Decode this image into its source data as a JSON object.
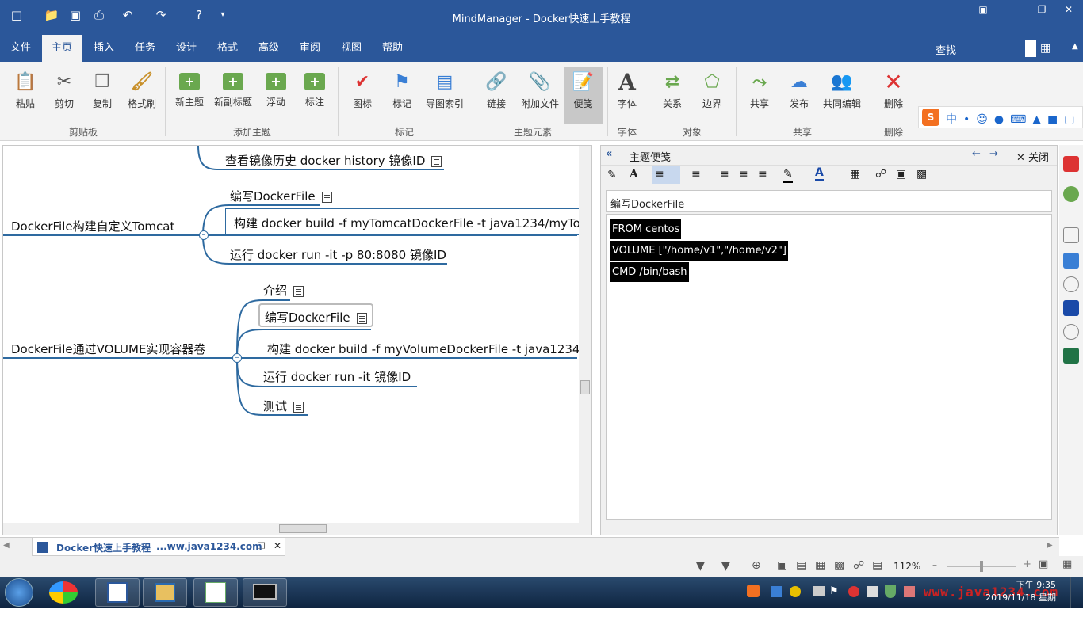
{
  "window": {
    "title": "MindManager - Docker快速上手教程"
  },
  "menu": {
    "tabs": [
      "文件",
      "主页",
      "插入",
      "任务",
      "设计",
      "格式",
      "高级",
      "审阅",
      "视图",
      "帮助"
    ],
    "active": "主页",
    "search_label": "查找"
  },
  "ribbon": {
    "buttons": [
      {
        "label": "粘贴",
        "icon": "paste-icon"
      },
      {
        "label": "剪切",
        "icon": "cut-icon"
      },
      {
        "label": "复制",
        "icon": "copy-icon"
      },
      {
        "label": "格式刷",
        "icon": "format-painter-icon"
      },
      {
        "label": "新主题",
        "icon": "new-topic-icon"
      },
      {
        "label": "新副标题",
        "icon": "new-subtopic-icon"
      },
      {
        "label": "浮动",
        "icon": "floating-topic-icon"
      },
      {
        "label": "标注",
        "icon": "callout-icon"
      },
      {
        "label": "图标",
        "icon": "icon-marker-icon"
      },
      {
        "label": "标记",
        "icon": "tag-icon"
      },
      {
        "label": "导图索引",
        "icon": "map-index-icon"
      },
      {
        "label": "链接",
        "icon": "link-icon"
      },
      {
        "label": "附加文件",
        "icon": "attachment-icon"
      },
      {
        "label": "便笺",
        "icon": "notes-icon"
      },
      {
        "label": "字体",
        "icon": "font-icon"
      },
      {
        "label": "关系",
        "icon": "relationship-icon"
      },
      {
        "label": "边界",
        "icon": "boundary-icon"
      },
      {
        "label": "共享",
        "icon": "share-icon"
      },
      {
        "label": "发布",
        "icon": "publish-icon"
      },
      {
        "label": "共同编辑",
        "icon": "co-edit-icon"
      },
      {
        "label": "删除",
        "icon": "delete-icon"
      }
    ],
    "groups": [
      "剪贴板",
      "添加主题",
      "标记",
      "主题元素",
      "字体",
      "对象",
      "共享",
      "删除"
    ]
  },
  "map": {
    "topics": {
      "history": "查看镜像历史  docker history 镜像ID",
      "tomcat_main": "DockerFile构建自定义Tomcat",
      "tomcat_write": "编写DockerFile",
      "tomcat_build": "构建 docker build -f myTomcatDockerFile -t java1234/myTo",
      "tomcat_run": "运行 docker run -it -p 80:8080 镜像ID",
      "volume_main": "DockerFile通过VOLUME实现容器卷",
      "volume_intro": "介绍",
      "volume_write": "编写DockerFile",
      "volume_build": "构建 docker build -f myVolumeDockerFile -t java1234",
      "volume_run": "运行 docker run -it  镜像ID",
      "volume_test": "测试"
    }
  },
  "notes_panel": {
    "title": "主题便笺",
    "close_label": "关闭",
    "topic_title": "编写DockerFile",
    "lines": [
      "FROM centos",
      "VOLUME [\"/home/v1\",\"/home/v2\"]",
      "CMD /bin/bash"
    ]
  },
  "doc_tab": {
    "title": "Docker快速上手教程",
    "subtitle": "...ww.java1234.com"
  },
  "status": {
    "zoom": "112%"
  },
  "taskbar": {
    "clock_time": "下午 9:35",
    "clock_date": "2019/11/18 星期一",
    "watermark": "www.java1234.com"
  },
  "colors": {
    "accent": "#2b579a",
    "branch": "#2e6aa0",
    "taskbar": "#1a3552"
  }
}
